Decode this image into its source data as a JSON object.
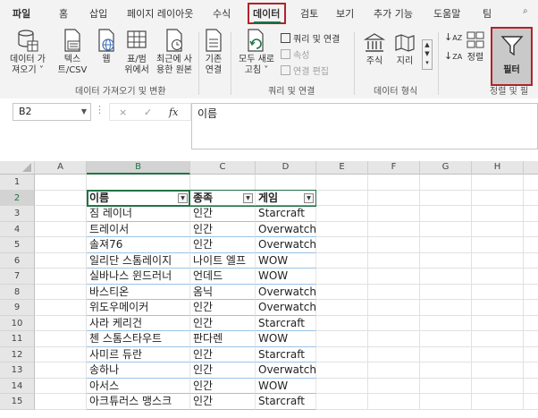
{
  "tabs": [
    "파일",
    "홈",
    "삽입",
    "페이지 레이아웃",
    "수식",
    "데이터",
    "검토",
    "보기",
    "추가 기능",
    "도움말",
    "팀"
  ],
  "active_tab": "데이터",
  "ribbon": {
    "get_data": [
      "데이터 가",
      "져오기 ˅"
    ],
    "text_csv": [
      "텍스",
      "트/CSV"
    ],
    "web": [
      "웹"
    ],
    "table_range": [
      "표/범",
      "위에서"
    ],
    "recent_sources": [
      "최근에 사",
      "용한 원본"
    ],
    "existing_conn": [
      "기존",
      "연결"
    ],
    "refresh_all": [
      "모두 새로",
      "고침 ˅"
    ],
    "queries_conn": "쿼리 및 연결",
    "properties": "속성",
    "edit_links": "연결 편집",
    "stocks": "주식",
    "geography": "지리",
    "sort": "정렬",
    "filter": "필터",
    "groups": {
      "get_transform": "데이터 가져오기 및 변환",
      "queries_connections": "쿼리 및 연결",
      "data_types": "데이터 형식",
      "sort_filter": "정렬 및 필"
    }
  },
  "formula_bar": {
    "name_box": "B2",
    "cancel": "×",
    "enter": "✓",
    "fx": "fx",
    "value": "이름"
  },
  "columns": [
    "A",
    "B",
    "C",
    "D",
    "E",
    "F",
    "G",
    "H"
  ],
  "rows": [
    "1",
    "2",
    "3",
    "4",
    "5",
    "6",
    "7",
    "8",
    "9",
    "10",
    "11",
    "12",
    "13",
    "14",
    "15"
  ],
  "table": {
    "headers": [
      "이름",
      "종족",
      "게임"
    ],
    "rows": [
      [
        "짐 레이너",
        "인간",
        "Starcraft"
      ],
      [
        "트레이서",
        "인간",
        "Overwatch"
      ],
      [
        "솔져76",
        "인간",
        "Overwatch"
      ],
      [
        "일리단 스톰레이지",
        "나이트 엘프",
        "WOW"
      ],
      [
        "실바나스 윈드러너",
        "언데드",
        "WOW"
      ],
      [
        "바스티온",
        "옴닉",
        "Overwatch"
      ],
      [
        "위도우메이커",
        "인간",
        "Overwatch"
      ],
      [
        "사라 케리건",
        "인간",
        "Starcraft"
      ],
      [
        "첸 스톰스타우트",
        "판다렌",
        "WOW"
      ],
      [
        "사미르 듀란",
        "인간",
        "Starcraft"
      ],
      [
        "송하나",
        "인간",
        "Overwatch"
      ],
      [
        "아서스",
        "인간",
        "WOW"
      ],
      [
        "아크튜러스 맹스크",
        "인간",
        "Starcraft"
      ]
    ]
  },
  "colors": {
    "accent": "#217346",
    "highlight": "#b0232a",
    "table_line": "#5b9bd5"
  }
}
